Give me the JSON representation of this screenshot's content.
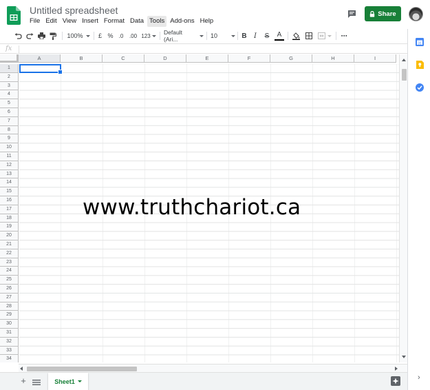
{
  "header": {
    "title": "Untitled spreadsheet",
    "share_label": "Share",
    "icons": {
      "logo": "sheets-logo-icon",
      "comments": "comments-icon",
      "lock": "lock-icon",
      "avatar": "user-avatar"
    }
  },
  "menu": {
    "items": [
      "File",
      "Edit",
      "View",
      "Insert",
      "Format",
      "Data",
      "Tools",
      "Add-ons",
      "Help"
    ],
    "active": "Tools"
  },
  "toolbar": {
    "zoom": "100%",
    "currency": "£",
    "percent": "%",
    "decrease_decimals": ".0",
    "increase_decimals": ".00",
    "more_formats": "123",
    "font": "Default (Ari...",
    "font_size": "10",
    "bold": "B",
    "italic": "I",
    "strikethrough": "S",
    "text_color": "A",
    "more": "⋯"
  },
  "formula_bar": {
    "fx": "fx",
    "value": ""
  },
  "grid": {
    "columns": [
      "A",
      "B",
      "C",
      "D",
      "E",
      "F",
      "G",
      "H",
      "I"
    ],
    "rows": [
      "1",
      "2",
      "3",
      "4",
      "5",
      "6",
      "7",
      "8",
      "9",
      "10",
      "11",
      "12",
      "13",
      "14",
      "15",
      "16",
      "17",
      "18",
      "19",
      "20",
      "21",
      "22",
      "23",
      "24",
      "25",
      "26",
      "27",
      "28",
      "29",
      "30",
      "31",
      "32",
      "33",
      "34"
    ],
    "selected_cell": "A1"
  },
  "watermark": "www.truthchariot.ca",
  "sheets": {
    "tabs": [
      "Sheet1"
    ],
    "active": "Sheet1",
    "add_label": "+"
  },
  "colors": {
    "share_green": "#188038",
    "selection_blue": "#1a73e8",
    "sheets_green": "#0f9d58"
  }
}
